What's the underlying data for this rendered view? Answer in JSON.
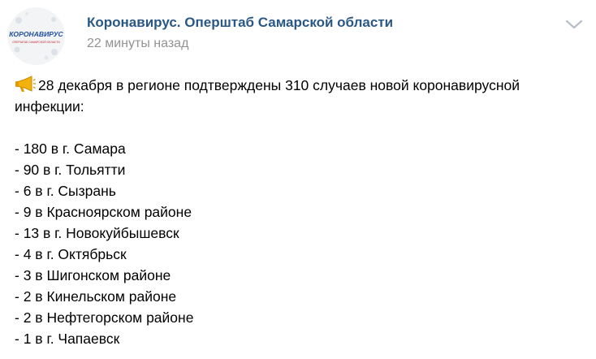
{
  "post": {
    "author": {
      "name": "Коронавирус. Оперштаб Самарской области",
      "avatar_text_main": "КОРОНАВИРУС",
      "avatar_text_sub": "ОПЕРШТАБ САМАРСКОЙ ОБЛАСТИ",
      "avatar_icon": "coronavirus-logo-icon"
    },
    "time": "22 минуты назад",
    "menu_icon": "chevron-down-icon",
    "intro_icon": "megaphone-icon",
    "intro_line1": "28 декабря в регионе подтверждены 310 случаев новой коронавирусной",
    "intro_line2": "инфекции:",
    "cases": [
      "- 180 в г. Самара",
      "- 90 в г. Тольятти",
      "- 6 в г. Сызрань",
      "- 9 в Красноярском районе",
      "- 13 в г. Новокуйбышевск",
      "- 4 в г. Октябрьск",
      "- 3 в Шигонском районе",
      "- 2 в Кинельском районе",
      "- 2 в Нефтегорском районе",
      "- 1 в г. Чапаевск"
    ]
  },
  "colors": {
    "link": "#2a5885",
    "muted": "#939393",
    "avatar_blue": "#1f4fa0",
    "avatar_red": "#c0272d",
    "megaphone": "#f3b20b"
  }
}
